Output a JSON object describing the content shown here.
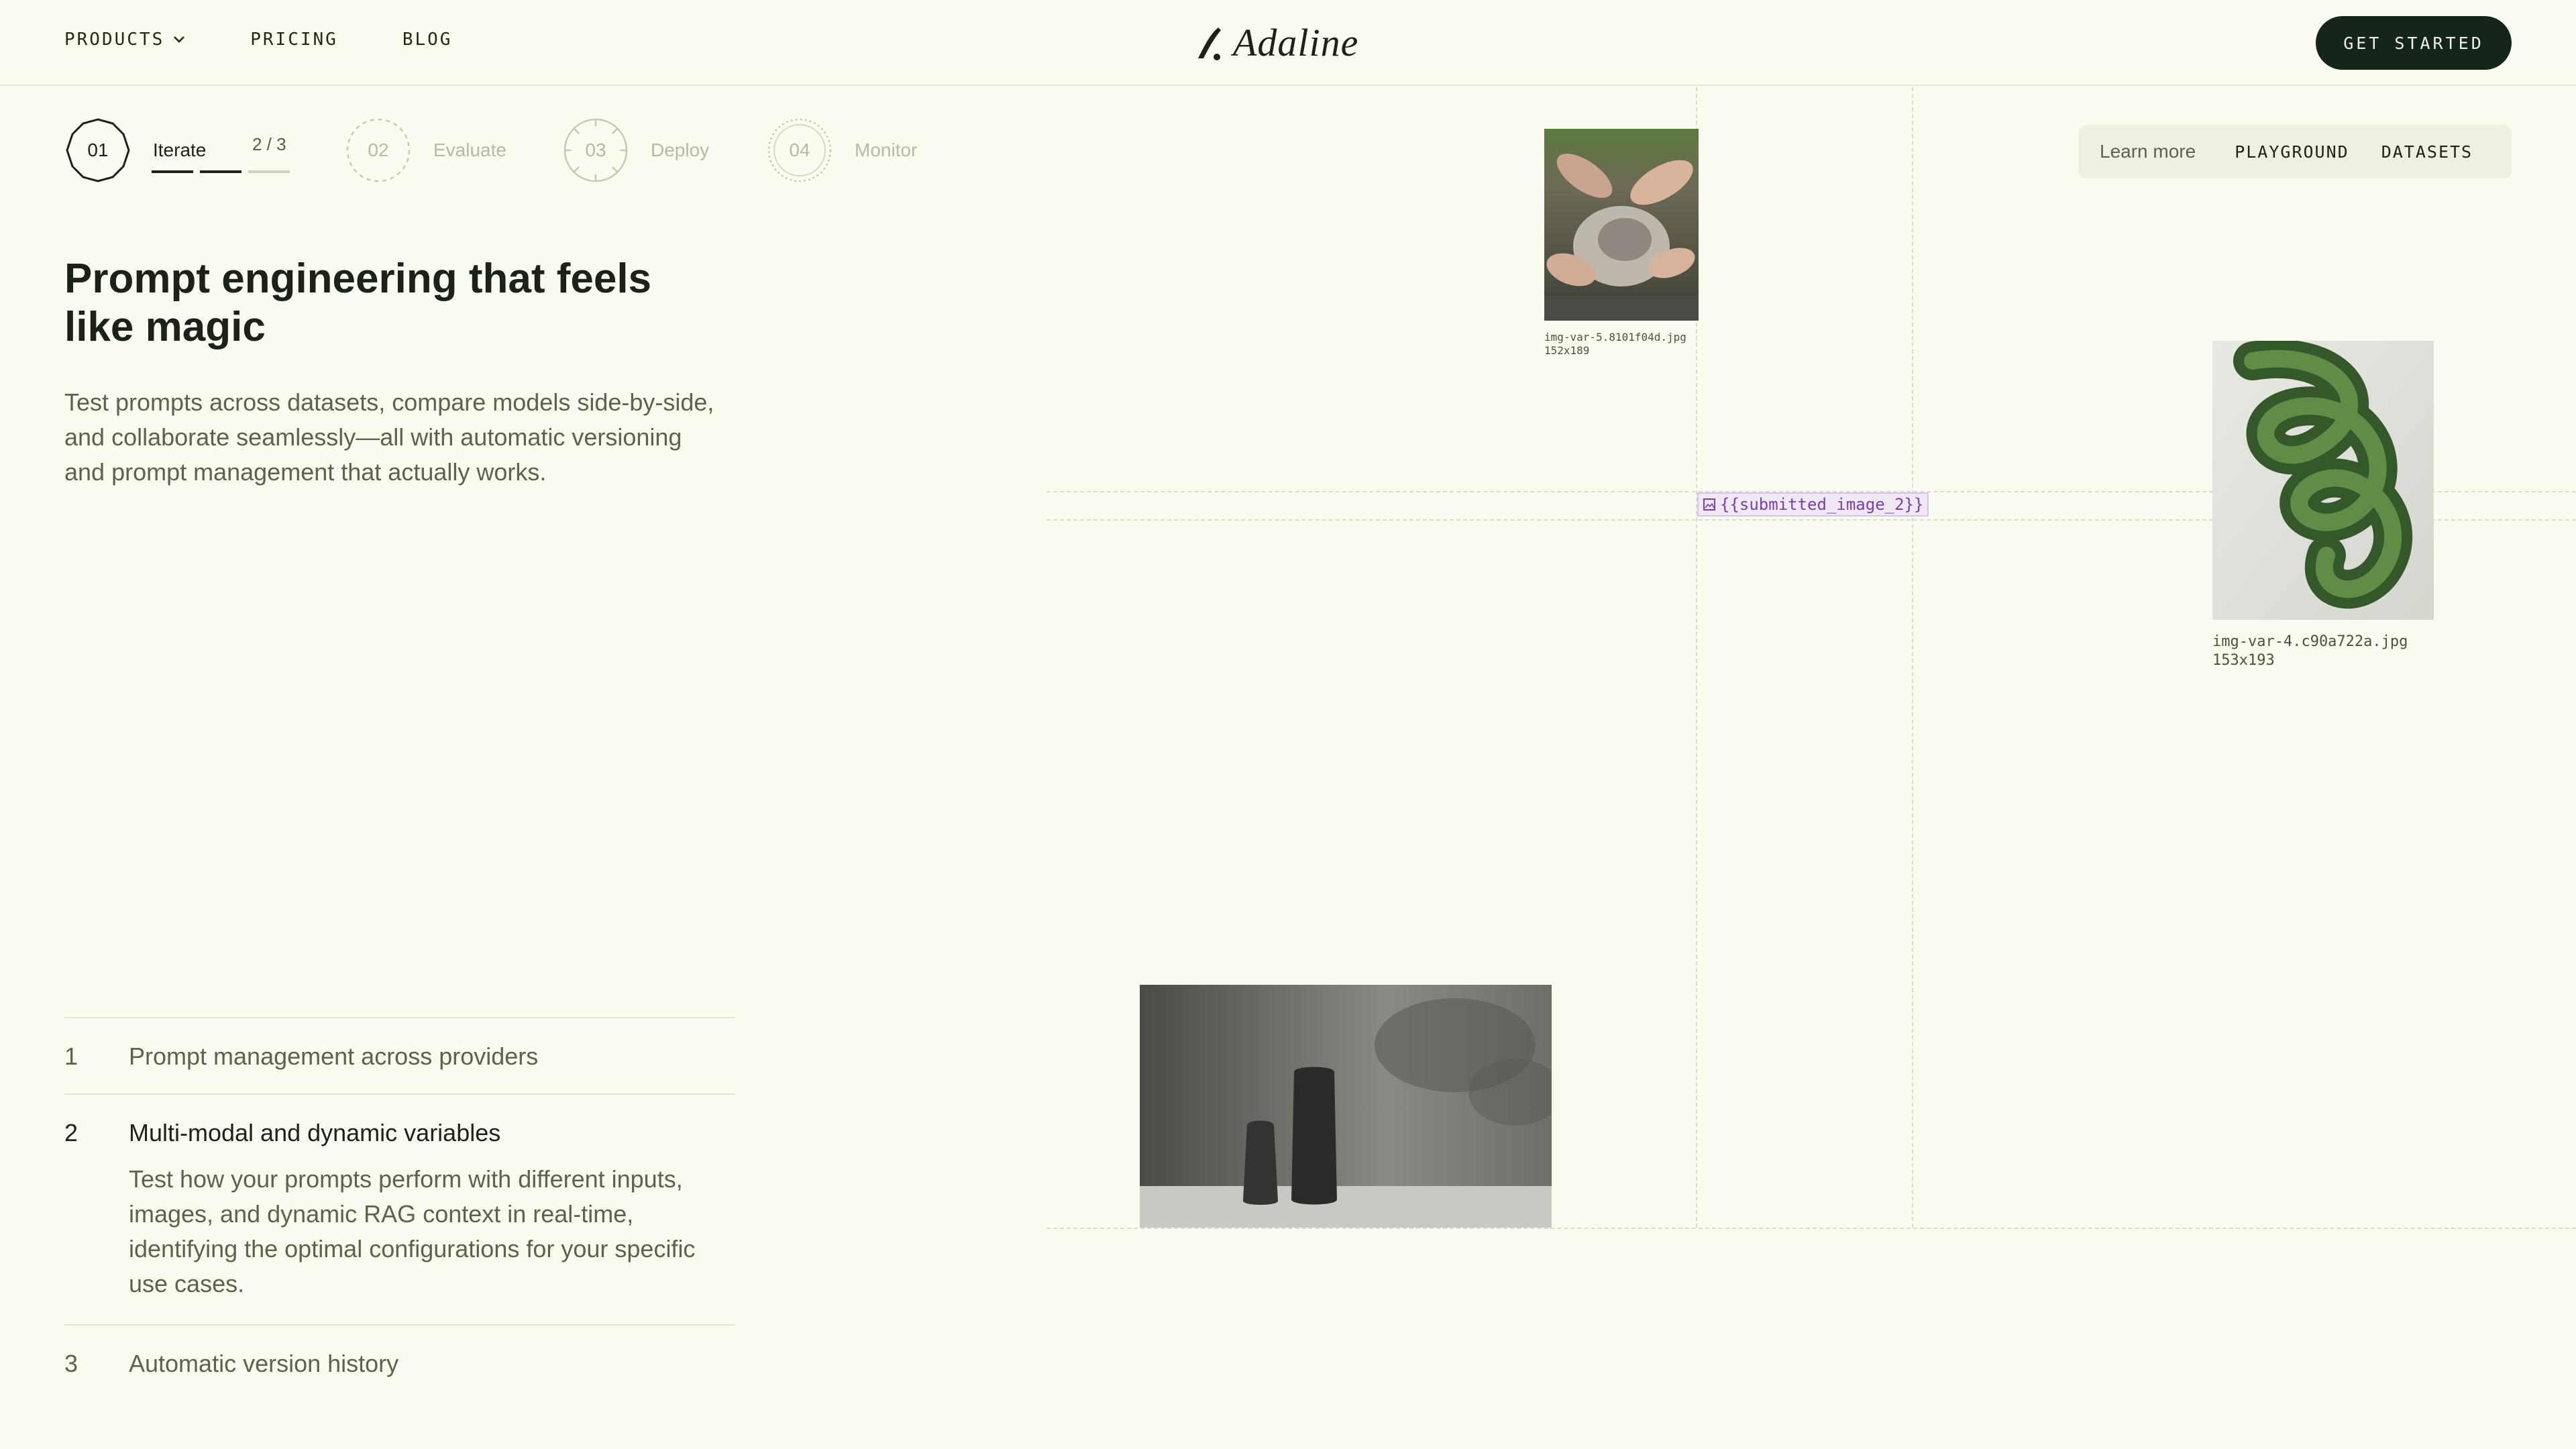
{
  "header": {
    "nav": [
      {
        "label": "PRODUCTS",
        "has_dropdown": true
      },
      {
        "label": "PRICING"
      },
      {
        "label": "BLOG"
      }
    ],
    "logo_text": "Adaline",
    "cta_label": "GET STARTED"
  },
  "steps": [
    {
      "number": "01",
      "label": "Iterate",
      "active": true
    },
    {
      "number": "02",
      "label": "Evaluate"
    },
    {
      "number": "03",
      "label": "Deploy"
    },
    {
      "number": "04",
      "label": "Monitor"
    }
  ],
  "step_progress": {
    "text": "2 / 3",
    "current": 2,
    "total": 3
  },
  "hero": {
    "title_line1": "Prompt engineering that feels",
    "title_line2": "like magic",
    "description": "Test prompts across datasets, compare models side-by-side, and collaborate seamlessly—all with automatic versioning and prompt management that actually works."
  },
  "features": [
    {
      "number": "1",
      "title": "Prompt management across providers"
    },
    {
      "number": "2",
      "title": "Multi-modal and dynamic variables",
      "body": "Test how your prompts perform with different inputs, images, and dynamic RAG context in real-time, identifying the optimal configurations for your specific use cases."
    },
    {
      "number": "3",
      "title": "Automatic version history"
    }
  ],
  "canvas": {
    "images": [
      {
        "filename": "img-var-5.8101f04d.jpg",
        "dims": "152x189"
      },
      {
        "filename": "img-var-4.c90a722a.jpg",
        "dims": "153x193"
      }
    ],
    "variable_chip": "{{submitted_image_2}}"
  },
  "tabs": {
    "learn_more": "Learn more",
    "items": [
      "PLAYGROUND",
      "DATASETS"
    ]
  },
  "colors": {
    "background": "#fafbf1",
    "text": "#1b2316",
    "cta_bg": "#15251a",
    "variable_chip": "#7a3fb0"
  }
}
